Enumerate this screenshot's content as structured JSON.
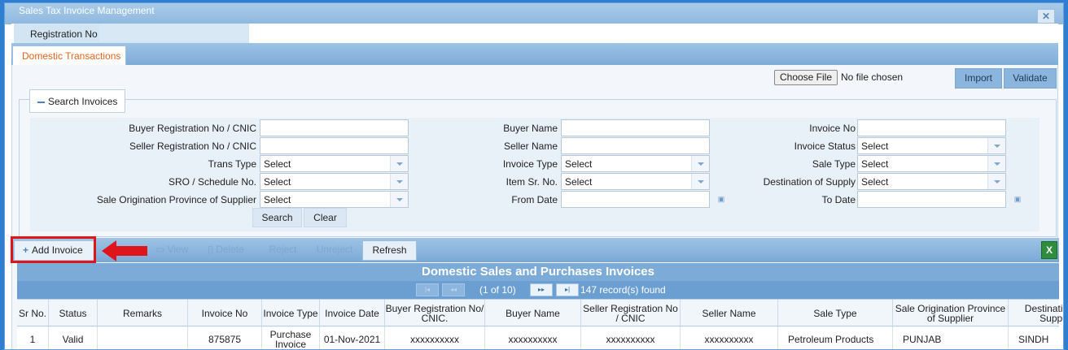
{
  "window": {
    "title": "Sales Tax Invoice Management",
    "close_glyph": "✕"
  },
  "registration": {
    "label": "Registration No",
    "value": ""
  },
  "tabs": [
    {
      "label": "Domestic Transactions",
      "active": true
    }
  ],
  "file_upload": {
    "choose_label": "Choose File",
    "status": "No file chosen"
  },
  "actions": {
    "import_label": "Import",
    "validate_label": "Validate"
  },
  "search": {
    "legend": "Search Invoices",
    "fields": {
      "buyer_reg": {
        "label": "Buyer Registration No / CNIC",
        "value": ""
      },
      "buyer_name": {
        "label": "Buyer Name",
        "value": ""
      },
      "invoice_no": {
        "label": "Invoice No",
        "value": ""
      },
      "seller_reg": {
        "label": "Seller Registration No / CNIC",
        "value": ""
      },
      "seller_name": {
        "label": "Seller Name",
        "value": ""
      },
      "invoice_status": {
        "label": "Invoice Status",
        "value": "Select"
      },
      "trans_type": {
        "label": "Trans Type",
        "value": "Select"
      },
      "invoice_type": {
        "label": "Invoice Type",
        "value": "Select"
      },
      "sale_type": {
        "label": "Sale Type",
        "value": "Select"
      },
      "sro": {
        "label": "SRO / Schedule No.",
        "value": "Select"
      },
      "item_sr": {
        "label": "Item Sr. No.",
        "value": "Select"
      },
      "destination": {
        "label": "Destination of Supply",
        "value": "Select"
      },
      "origination": {
        "label": "Sale Origination Province of Supplier",
        "value": "Select"
      },
      "from_date": {
        "label": "From Date",
        "value": ""
      },
      "to_date": {
        "label": "To Date",
        "value": ""
      }
    },
    "search_label": "Search",
    "clear_label": "Clear"
  },
  "toolbar": {
    "add_label": "Add Invoice",
    "view_label": "View",
    "delete_label": "Delete",
    "reject_label": "Reject",
    "unreject_label": "Unreject",
    "refresh_label": "Refresh",
    "excel_icon": "excel-export-icon",
    "highlight_color": "#e0151b"
  },
  "grid": {
    "title": "Domestic Sales and Purchases Invoices",
    "page_text": "(1 of 10)",
    "records_text": "147 record(s) found",
    "current_page": 1,
    "total_pages": 10,
    "total_records": 147,
    "columns": [
      "Sr No.",
      "Status",
      "Remarks",
      "Invoice No",
      "Invoice Type",
      "Invoice Date",
      "Buyer Registration No/ CNIC.",
      "Buyer Name",
      "Seller Registration No / CNIC",
      "Seller Name",
      "Sale Type",
      "Sale Origination Province of Supplier",
      "Destination of Supply"
    ],
    "rows": [
      [
        "1",
        "Valid",
        "",
        "875875",
        "Purchase Invoice",
        "01-Nov-2021",
        "xxxxxxxxxx",
        "xxxxxxxxxx",
        "xxxxxxxxxx",
        "xxxxxxxxxx",
        "Petroleum Products",
        "PUNJAB",
        "SINDH"
      ]
    ]
  }
}
